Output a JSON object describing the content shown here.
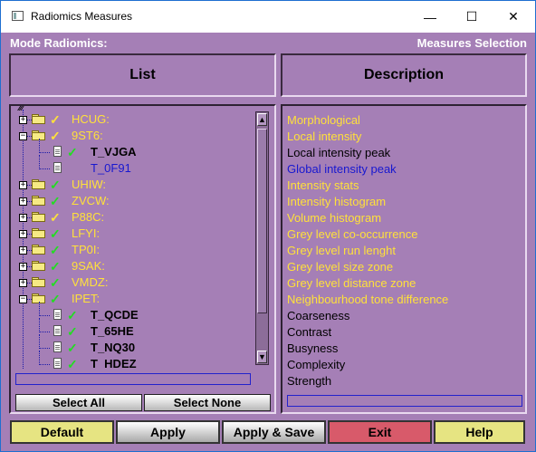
{
  "window": {
    "title": "Radiomics Measures",
    "minimize_glyph": "—",
    "maximize_glyph": "☐",
    "close_glyph": "✕"
  },
  "header": {
    "mode_label": "Mode Radiomics:",
    "measures_label": "Measures Selection"
  },
  "list_panel": {
    "title": "List",
    "root_glyph": "⁄⁄⁄",
    "select_all": "Select All",
    "select_none": "Select None",
    "search_value": "",
    "tree": [
      {
        "label": "HCUG:",
        "type": "folder",
        "expanded": false,
        "check_color": "#ffe13a",
        "label_color": "#ffe13a"
      },
      {
        "label": "9ST6:",
        "type": "folder",
        "expanded": true,
        "check_color": "#ffe13a",
        "label_color": "#ffe13a"
      },
      {
        "label": "T_VJGA",
        "type": "item",
        "check_color": "#22dd22",
        "label_color": "#000000"
      },
      {
        "label": "T_0F91",
        "type": "item",
        "check_color": "",
        "label_color": "#1818d0"
      },
      {
        "label": "UHIW:",
        "type": "folder",
        "expanded": false,
        "check_color": "#22dd22",
        "label_color": "#ffe13a"
      },
      {
        "label": "ZVCW:",
        "type": "folder",
        "expanded": false,
        "check_color": "#22dd22",
        "label_color": "#ffe13a"
      },
      {
        "label": "P88C:",
        "type": "folder",
        "expanded": false,
        "check_color": "#ffe13a",
        "label_color": "#ffe13a"
      },
      {
        "label": "LFYI:",
        "type": "folder",
        "expanded": false,
        "check_color": "#22dd22",
        "label_color": "#ffe13a"
      },
      {
        "label": "TP0I:",
        "type": "folder",
        "expanded": false,
        "check_color": "#22dd22",
        "label_color": "#ffe13a"
      },
      {
        "label": "9SAK:",
        "type": "folder",
        "expanded": false,
        "check_color": "#22dd22",
        "label_color": "#ffe13a"
      },
      {
        "label": "VMDZ:",
        "type": "folder",
        "expanded": false,
        "check_color": "#22dd22",
        "label_color": "#ffe13a"
      },
      {
        "label": "IPET:",
        "type": "folder",
        "expanded": true,
        "check_color": "#22dd22",
        "label_color": "#ffe13a"
      },
      {
        "label": "T_QCDE",
        "type": "item",
        "check_color": "#22dd22",
        "label_color": "#000000"
      },
      {
        "label": "T_65HE",
        "type": "item",
        "check_color": "#22dd22",
        "label_color": "#000000"
      },
      {
        "label": "T_NQ30",
        "type": "item",
        "check_color": "#22dd22",
        "label_color": "#000000"
      },
      {
        "label": "T_HDEZ",
        "type": "item",
        "check_color": "#22dd22",
        "label_color": "#000000"
      }
    ],
    "scroll_up": "▲",
    "scroll_down": "▼"
  },
  "description_panel": {
    "title": "Description",
    "search_value": "",
    "items": [
      {
        "text": "Morphological",
        "color": "#ffe13a"
      },
      {
        "text": "Local intensity",
        "color": "#ffe13a"
      },
      {
        "text": "Local intensity peak",
        "color": "#000000"
      },
      {
        "text": "Global intensity peak",
        "color": "#1818d0"
      },
      {
        "text": "Intensity stats",
        "color": "#ffe13a"
      },
      {
        "text": "Intensity histogram",
        "color": "#ffe13a"
      },
      {
        "text": "Volume histogram",
        "color": "#ffe13a"
      },
      {
        "text": "Grey level co-occurrence",
        "color": "#ffe13a"
      },
      {
        "text": "Grey level run lenght",
        "color": "#ffe13a"
      },
      {
        "text": "Grey level size zone",
        "color": "#ffe13a"
      },
      {
        "text": "Grey level distance zone",
        "color": "#ffe13a"
      },
      {
        "text": "Neighbourhood tone difference",
        "color": "#ffe13a"
      },
      {
        "text": "Coarseness",
        "color": "#000000"
      },
      {
        "text": "Contrast",
        "color": "#000000"
      },
      {
        "text": "Busyness",
        "color": "#000000"
      },
      {
        "text": "Complexity",
        "color": "#000000"
      },
      {
        "text": "Strength",
        "color": "#000000"
      }
    ]
  },
  "buttons": {
    "default": "Default",
    "apply": "Apply",
    "apply_save": "Apply & Save",
    "exit": "Exit",
    "help": "Help"
  },
  "colors": {
    "background": "#a57fb6",
    "yellow": "#ffe13a",
    "green_check": "#22dd22",
    "blue": "#1818d0",
    "default_button": "#e6e482",
    "exit_button": "#d85a6a"
  }
}
